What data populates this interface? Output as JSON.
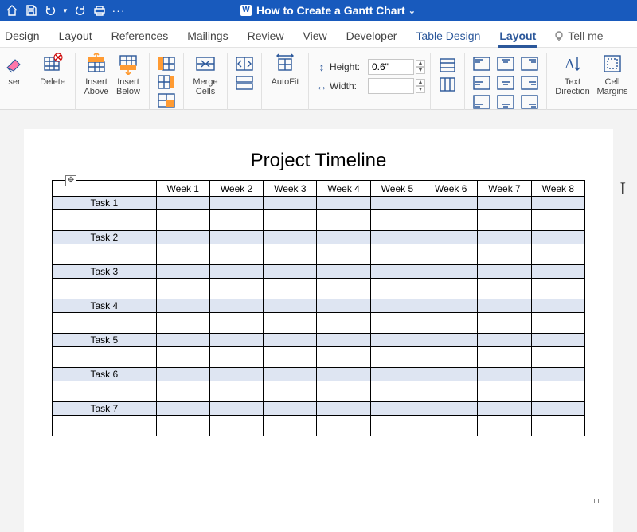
{
  "title": "How to Create a Gantt Chart",
  "tabs": {
    "design": "Design",
    "layout1": "Layout",
    "references": "References",
    "mailings": "Mailings",
    "review": "Review",
    "view": "View",
    "developer": "Developer",
    "table_design": "Table Design",
    "layout2": "Layout",
    "tellme": "Tell me"
  },
  "ribbon": {
    "ser": "ser",
    "delete": "Delete",
    "insert_above": "Insert\nAbove",
    "insert_below": "Insert\nBelow",
    "merge_cells": "Merge\nCells",
    "autofit": "AutoFit",
    "height_label": "Height:",
    "height_value": "0.6\"",
    "width_label": "Width:",
    "width_value": "",
    "text_direction": "Text\nDirection",
    "cell_margins": "Cell\nMargins"
  },
  "document": {
    "title": "Project Timeline",
    "weeks": [
      "Week 1",
      "Week 2",
      "Week 3",
      "Week 4",
      "Week 5",
      "Week 6",
      "Week 7",
      "Week 8"
    ],
    "tasks": [
      "Task 1",
      "Task 2",
      "Task 3",
      "Task 4",
      "Task 5",
      "Task 6",
      "Task 7"
    ]
  },
  "chart_data": {
    "type": "table",
    "title": "Project Timeline",
    "columns": [
      "",
      "Week 1",
      "Week 2",
      "Week 3",
      "Week 4",
      "Week 5",
      "Week 6",
      "Week 7",
      "Week 8"
    ],
    "rows": [
      {
        "label": "Task 1",
        "cells": [
          "",
          "",
          "",
          "",
          "",
          "",
          "",
          ""
        ]
      },
      {
        "label": "Task 2",
        "cells": [
          "",
          "",
          "",
          "",
          "",
          "",
          "",
          ""
        ]
      },
      {
        "label": "Task 3",
        "cells": [
          "",
          "",
          "",
          "",
          "",
          "",
          "",
          ""
        ]
      },
      {
        "label": "Task 4",
        "cells": [
          "",
          "",
          "",
          "",
          "",
          "",
          "",
          ""
        ]
      },
      {
        "label": "Task 5",
        "cells": [
          "",
          "",
          "",
          "",
          "",
          "",
          "",
          ""
        ]
      },
      {
        "label": "Task 6",
        "cells": [
          "",
          "",
          "",
          "",
          "",
          "",
          "",
          ""
        ]
      },
      {
        "label": "Task 7",
        "cells": [
          "",
          "",
          "",
          "",
          "",
          "",
          "",
          ""
        ]
      }
    ]
  }
}
